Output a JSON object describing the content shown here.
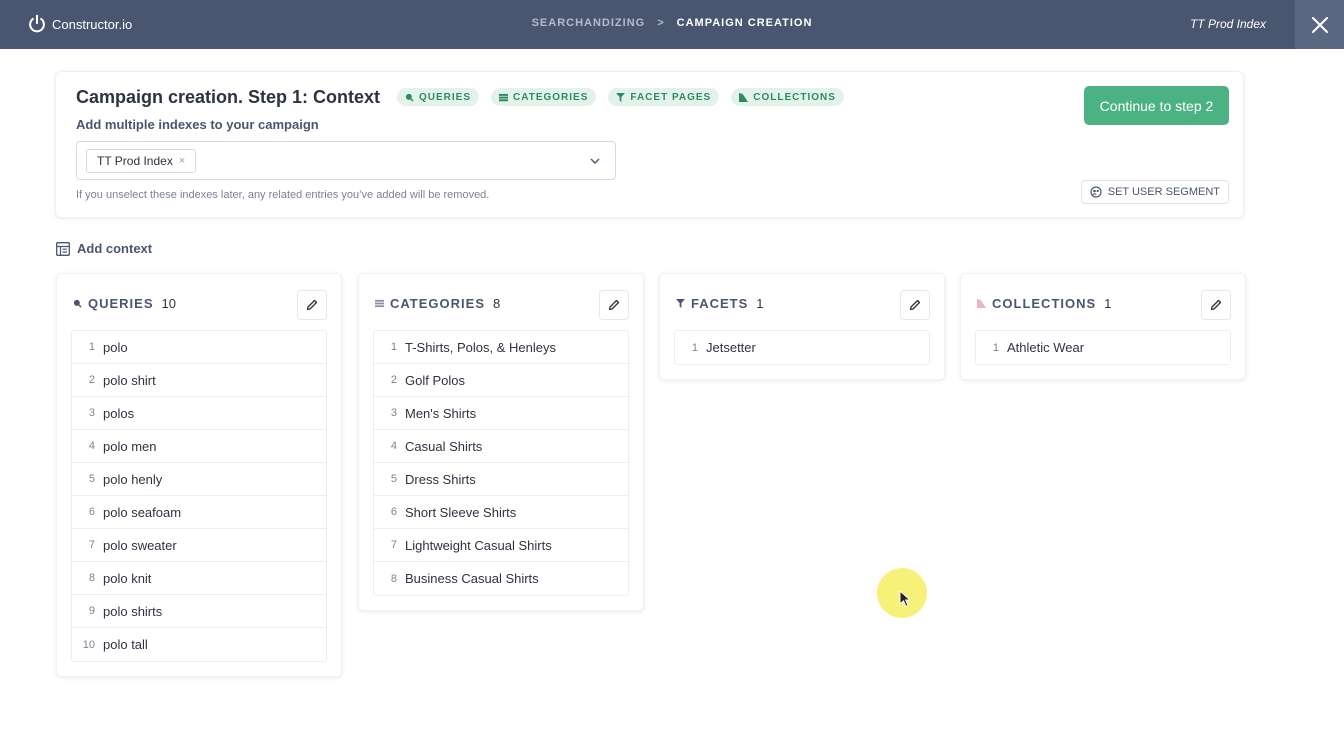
{
  "topbar": {
    "logo_text": "Constructor.io",
    "breadcrumb_1": "SEARCHANDIZING",
    "breadcrumb_sep": ">",
    "breadcrumb_2": "CAMPAIGN CREATION",
    "index_name": "TT Prod Index"
  },
  "header": {
    "title": "Campaign creation. Step 1: Context",
    "tags": [
      "QUERIES",
      "CATEGORIES",
      "FACET PAGES",
      "COLLECTIONS"
    ],
    "subtitle": "Add multiple indexes to your campaign",
    "selected_index": "TT Prod Index",
    "chip_remove": "×",
    "note": "If you unselect these indexes later, any related entries you’ve added will be removed.",
    "continue_label": "Continue to step 2",
    "segment_label": "SET USER SEGMENT"
  },
  "add_context_label": "Add context",
  "columns": {
    "queries": {
      "title": "QUERIES",
      "count": "10",
      "items": [
        "polo",
        "polo shirt",
        "polos",
        "polo men",
        "polo henly",
        "polo seafoam",
        "polo sweater",
        "polo knit",
        "polo shirts",
        "polo tall"
      ]
    },
    "categories": {
      "title": "CATEGORIES",
      "count": "8",
      "items": [
        "T-Shirts, Polos, & Henleys",
        "Golf Polos",
        "Men's Shirts",
        "Casual Shirts",
        "Dress Shirts",
        "Short Sleeve Shirts",
        "Lightweight Casual Shirts",
        "Business Casual Shirts"
      ]
    },
    "facets": {
      "title": "FACETS",
      "count": "1",
      "items": [
        "Jetsetter"
      ]
    },
    "collections": {
      "title": "COLLECTIONS",
      "count": "1",
      "items": [
        "Athletic Wear"
      ]
    }
  },
  "colors": {
    "topbar": "#4a5670",
    "accent_green": "#4bb383",
    "tag_bg": "#e3f3ec",
    "tag_text": "#2f8a61"
  },
  "icons": {
    "logo": "power-icon",
    "close": "close-icon",
    "queries": "search-icon",
    "categories": "list-icon",
    "facets": "filter-icon",
    "collections": "collection-icon",
    "edit": "pencil-icon",
    "segment": "segment-icon",
    "add_context": "table-icon"
  }
}
